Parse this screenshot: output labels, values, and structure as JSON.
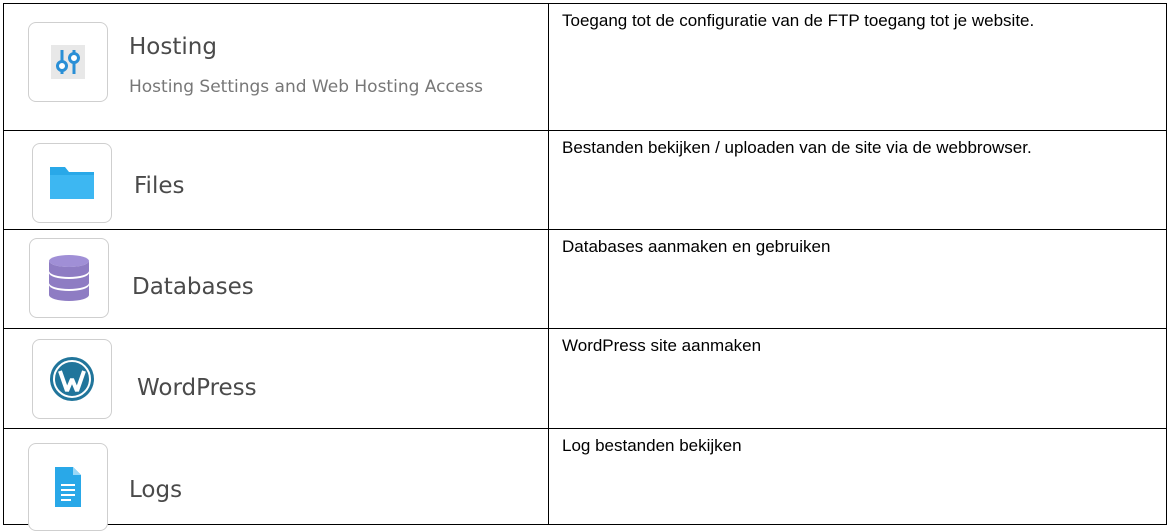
{
  "rows": [
    {
      "icon": "sliders-icon",
      "title": "Hosting",
      "subtitle": "Hosting Settings and Web Hosting Access",
      "description": "Toegang tot de configuratie van de FTP toegang tot je website."
    },
    {
      "icon": "folder-icon",
      "title": "Files",
      "description": "Bestanden bekijken / uploaden van de site via de webbrowser."
    },
    {
      "icon": "database-icon",
      "title": "Databases",
      "description": "Databases aanmaken en gebruiken"
    },
    {
      "icon": "wordpress-icon",
      "title": "WordPress",
      "description": "WordPress site aanmaken"
    },
    {
      "icon": "document-icon",
      "title": "Logs",
      "description": "Log bestanden bekijken"
    }
  ],
  "colors": {
    "folder": "#29A8E8",
    "database": "#8E7CC3",
    "wordpress": "#21759B",
    "sliders": "#2A8FD6"
  }
}
